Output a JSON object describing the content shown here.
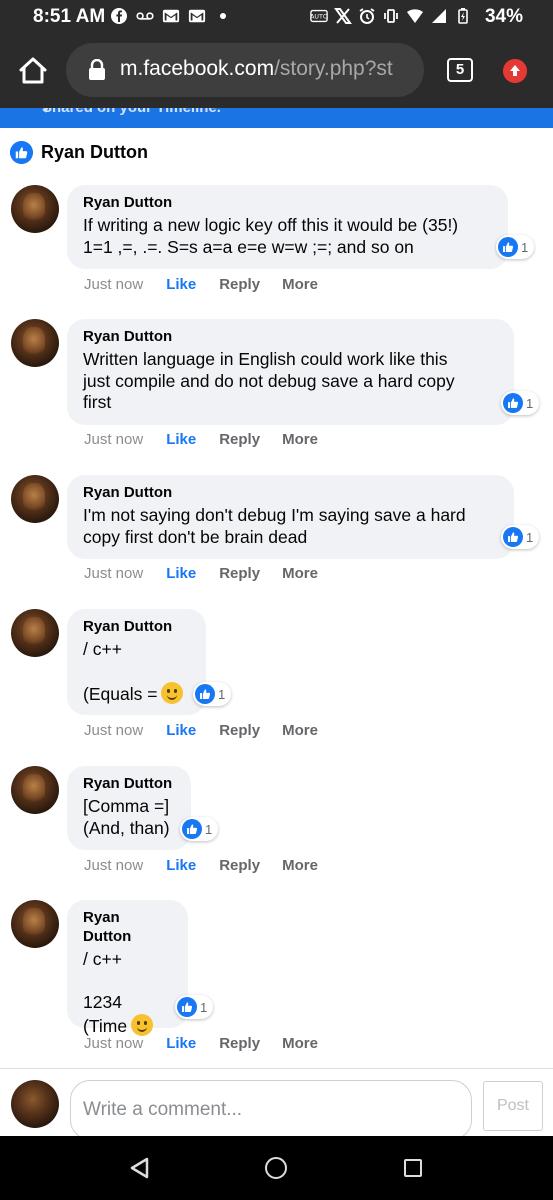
{
  "status_bar": {
    "time": "8:51 AM",
    "battery": "34%"
  },
  "browser": {
    "url_host": "m.facebook.com",
    "url_path": "/story.php?st",
    "tab_count": "5"
  },
  "banner": {
    "text": "Shared on your Timeline."
  },
  "reactor": {
    "name": "Ryan Dutton"
  },
  "comments": [
    {
      "author": "Ryan Dutton",
      "text": "If writing a new logic key off this it would be (35!)\n1=1 ,=, .=. S=s a=a e=e w=w ;=; and so on",
      "reactions": "1",
      "time": "Just now",
      "like": "Like",
      "reply": "Reply",
      "more": "More"
    },
    {
      "author": "Ryan Dutton",
      "text": "Written language in English could work like this\njust compile and do not debug save a hard copy\nfirst",
      "reactions": "1",
      "time": "Just now",
      "like": "Like",
      "reply": "Reply",
      "more": "More"
    },
    {
      "author": "Ryan Dutton",
      "text": "I'm not saying don't debug I'm saying save a hard\ncopy first don't be brain dead",
      "reactions": "1",
      "time": "Just now",
      "like": "Like",
      "reply": "Reply",
      "more": "More"
    },
    {
      "author": "Ryan Dutton",
      "text": "/ c++\n\n(Equals =",
      "emoji": "slightly-smiling-face",
      "reactions": "1",
      "time": "Just now",
      "like": "Like",
      "reply": "Reply",
      "more": "More"
    },
    {
      "author": "Ryan Dutton",
      "text": "[Comma =]\n(And, than)",
      "reactions": "1",
      "time": "Just now",
      "like": "Like",
      "reply": "Reply",
      "more": "More"
    },
    {
      "author": "Ryan Dutton",
      "text": "/ c++\n\n1234\n(Time",
      "emoji": "smiling-face",
      "reactions": "1",
      "time": "Just now",
      "like": "Like",
      "reply": "Reply",
      "more": "More"
    }
  ],
  "composer": {
    "placeholder": "Write a comment...",
    "post_label": "Post"
  },
  "colors": {
    "brand_blue": "#1877f2",
    "bubble_bg": "#f0f2f5",
    "chrome_dark": "#2b2b2b"
  }
}
